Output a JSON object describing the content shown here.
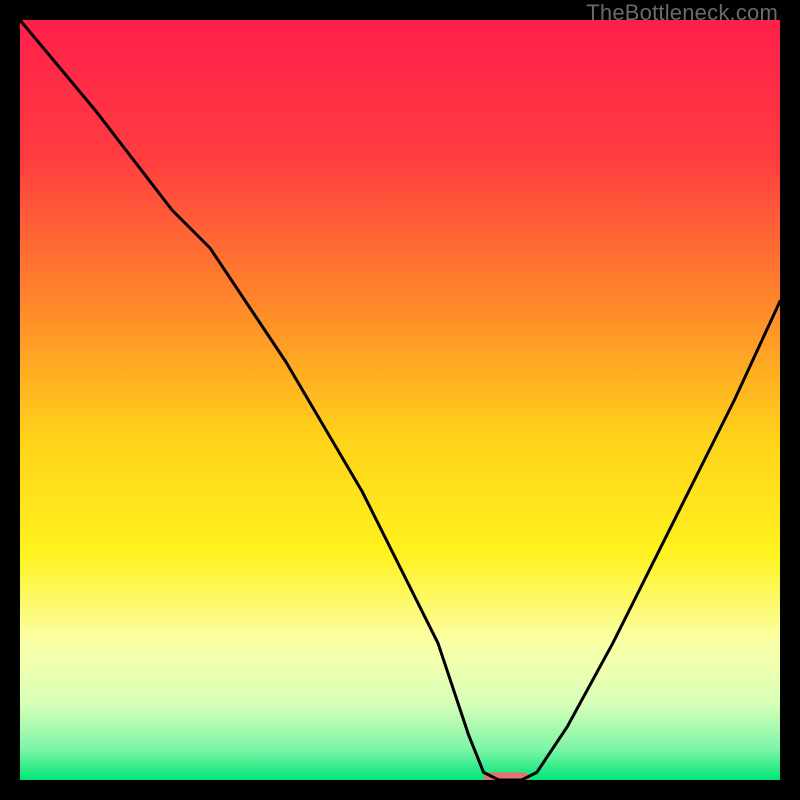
{
  "source_label": "TheBottleneck.com",
  "chart_data": {
    "type": "line",
    "title": "",
    "xlabel": "",
    "ylabel": "",
    "xlim": [
      0,
      100
    ],
    "ylim": [
      0,
      100
    ],
    "grid": false,
    "background": {
      "stops": [
        {
          "offset": 0,
          "color": "#ff1f4b"
        },
        {
          "offset": 18,
          "color": "#ff3c40"
        },
        {
          "offset": 38,
          "color": "#ff8a2a"
        },
        {
          "offset": 55,
          "color": "#ffd21a"
        },
        {
          "offset": 70,
          "color": "#fff21e"
        },
        {
          "offset": 82,
          "color": "#fbffa8"
        },
        {
          "offset": 90,
          "color": "#d8ffb8"
        },
        {
          "offset": 96,
          "color": "#7cf5a8"
        },
        {
          "offset": 100,
          "color": "#00e676"
        }
      ]
    },
    "series": [
      {
        "name": "bottleneck-curve",
        "color": "#000000",
        "x": [
          0,
          10,
          20,
          25,
          35,
          45,
          55,
          59,
          61,
          63,
          66,
          68,
          72,
          78,
          86,
          94,
          100
        ],
        "y": [
          100,
          88,
          75,
          70,
          55,
          38,
          18,
          6,
          1,
          0,
          0,
          1,
          7,
          18,
          34,
          50,
          63
        ]
      }
    ],
    "marker": {
      "name": "optimal-zone",
      "color": "#e4736f",
      "x_start": 61,
      "x_end": 67,
      "y": 0,
      "height_pct": 1.2
    }
  }
}
